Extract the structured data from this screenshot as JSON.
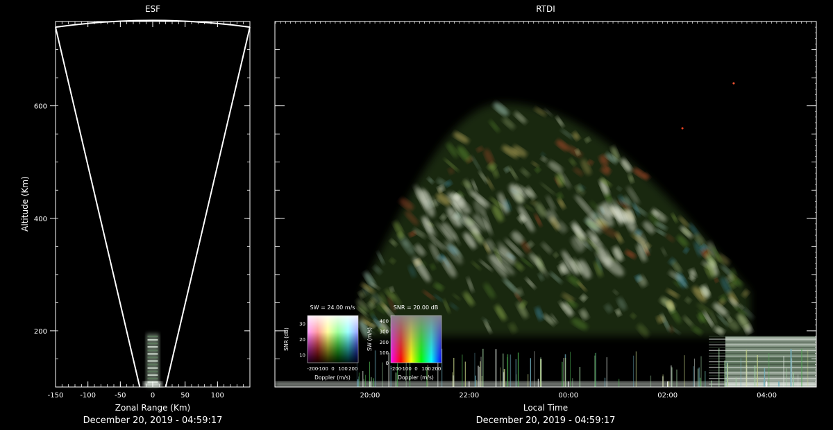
{
  "chart_data": [
    {
      "type": "scatter",
      "title": "ESF",
      "xlabel": "Zonal Range (Km)",
      "ylabel": "Altitude (Km)",
      "xlim": [
        -150,
        150
      ],
      "ylim": [
        100,
        750
      ],
      "x_ticks": [
        -150,
        -100,
        -50,
        0,
        50,
        100
      ],
      "y_ticks": [
        200,
        400,
        600
      ],
      "footer": "December 20, 2019 - 04:59:17",
      "sector_edges": [
        {
          "range": -150,
          "altitude": 740
        },
        {
          "range": 150,
          "altitude": 740
        },
        {
          "range": -20,
          "altitude": 100
        },
        {
          "range": 20,
          "altitude": 100
        }
      ],
      "sector_top": {
        "range": 0,
        "altitude": 752
      },
      "echo_column": {
        "range": [
          -20,
          20
        ],
        "altitude": [
          100,
          195
        ]
      }
    },
    {
      "type": "heatmap",
      "title": "RTDI",
      "xlabel": "Local Time",
      "xlim": [
        "18:05",
        "05:00"
      ],
      "ylim": [
        100,
        750
      ],
      "x_ticks": [
        "20:00",
        "22:00",
        "00:00",
        "02:00",
        "04:00"
      ],
      "footer": "December 20, 2019 - 04:59:17",
      "plume": {
        "time_start": "19:50",
        "time_peak": "22:40",
        "time_end": "03:40",
        "altitude_base": 270,
        "altitude_peak": 605
      },
      "bottom_layer": {
        "altitude": [
          100,
          190
        ]
      },
      "legends": [
        {
          "caption": "SW = 24.00 m/s",
          "xlabel": "Doppler (m/s)",
          "ylabel": "SNR (dB)",
          "x_ticks": [
            -200,
            -100,
            0,
            100,
            200
          ],
          "y_ticks": [
            10,
            20,
            30
          ],
          "ylim": [
            5,
            35
          ]
        },
        {
          "caption": "SNR = 20.00 dB",
          "xlabel": "Doppler (m/s)",
          "ylabel": "SW (m/s)",
          "x_ticks": [
            -200,
            -100,
            0,
            100,
            200
          ],
          "y_ticks": [
            0,
            100,
            200,
            300,
            400
          ],
          "ylim": [
            0,
            450
          ]
        }
      ]
    }
  ]
}
